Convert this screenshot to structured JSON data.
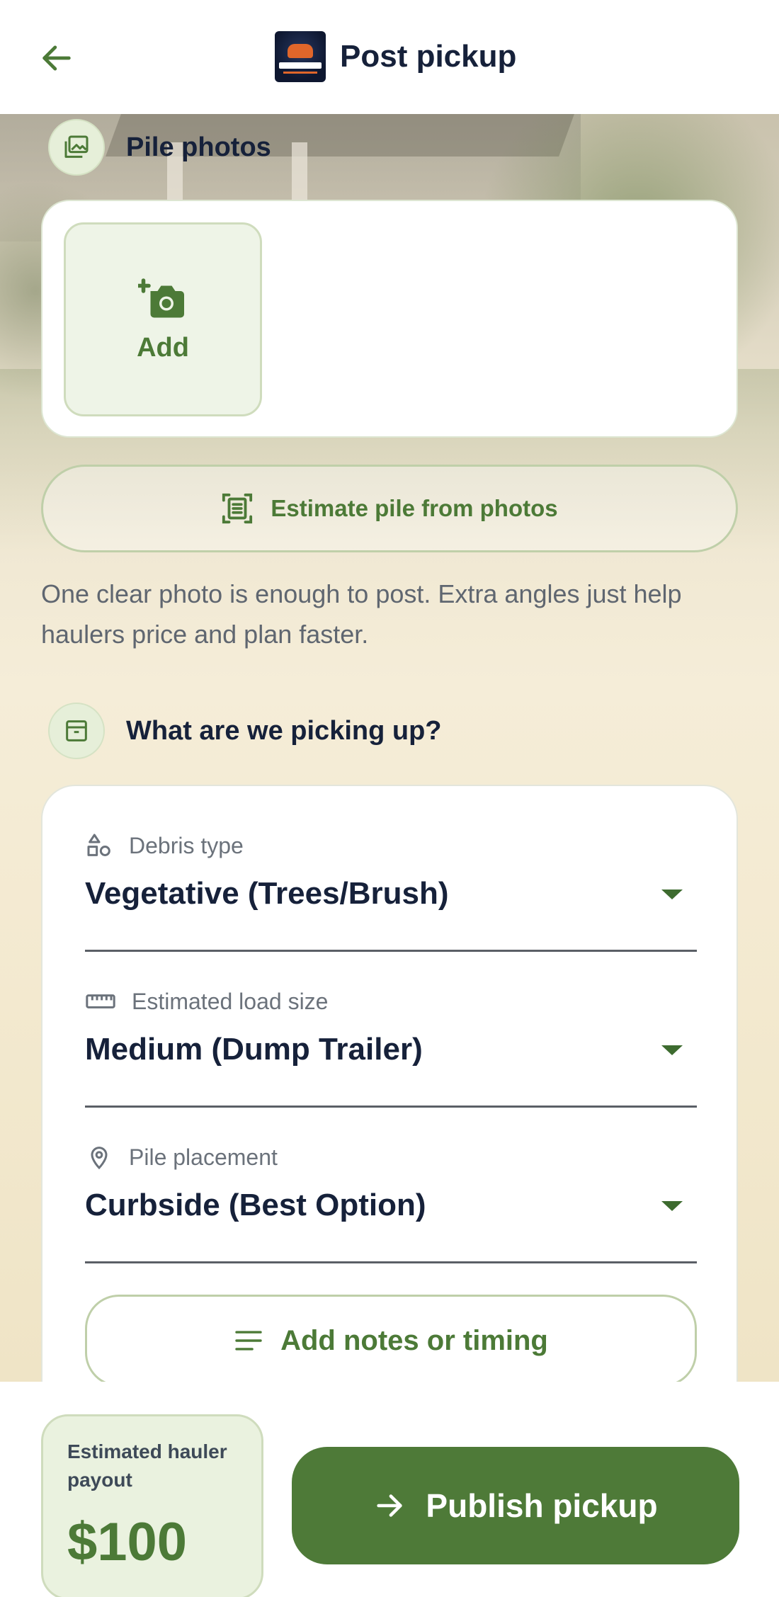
{
  "header": {
    "title": "Post pickup",
    "back_icon": "arrow-left-icon",
    "logo": "debrisdash-logo"
  },
  "photos_section": {
    "title": "Pile photos",
    "icon": "image-icon",
    "add_label": "Add",
    "add_icon": "camera-plus-icon"
  },
  "estimate_button": {
    "label": "Estimate pile from photos",
    "icon": "scan-document-icon"
  },
  "hint_text": "One clear photo is enough to post. Extra angles just help haulers price and plan faster.",
  "details_section": {
    "title": "What are we picking up?",
    "icon": "archive-box-icon",
    "fields": [
      {
        "label": "Debris type",
        "value": "Vegetative (Trees/Brush)",
        "icon": "shapes-icon"
      },
      {
        "label": "Estimated load size",
        "value": "Medium (Dump Trailer)",
        "icon": "ruler-icon"
      },
      {
        "label": "Pile placement",
        "value": "Curbside (Best Option)",
        "icon": "map-pin-icon"
      }
    ],
    "notes_button": {
      "label": "Add notes or timing",
      "icon": "notes-lines-icon"
    }
  },
  "footer": {
    "payout_label": "Estimated hauler payout",
    "payout_value": "$100",
    "publish_label": "Publish pickup",
    "publish_icon": "arrow-right-icon"
  },
  "colors": {
    "brand_green": "#4e7a38",
    "light_green": "#eaf2df",
    "text_dark": "#16213a",
    "text_muted": "#6b727b"
  }
}
